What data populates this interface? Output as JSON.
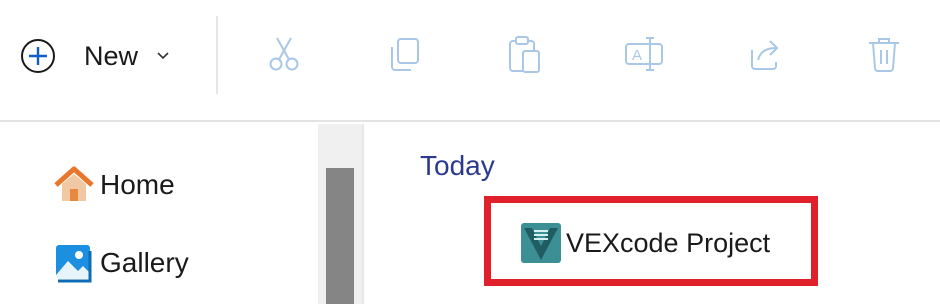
{
  "toolbar": {
    "new_label": "New",
    "tools": [
      {
        "icon": "cut-icon",
        "enabled": false
      },
      {
        "icon": "copy-icon",
        "enabled": false
      },
      {
        "icon": "paste-icon",
        "enabled": false
      },
      {
        "icon": "rename-icon",
        "enabled": false
      },
      {
        "icon": "share-icon",
        "enabled": false
      },
      {
        "icon": "delete-icon",
        "enabled": false
      }
    ]
  },
  "nav": {
    "items": [
      {
        "label": "Home",
        "icon": "home-icon"
      },
      {
        "label": "Gallery",
        "icon": "gallery-icon"
      }
    ]
  },
  "content": {
    "group_header": "Today",
    "files": [
      {
        "name": "VEXcode Project",
        "icon": "vexcode-file-icon",
        "highlighted": true
      }
    ]
  },
  "colors": {
    "accent_plus": "#0f5ec4",
    "disabled_icon": "#a9c8e8",
    "group_header": "#2b3a8f",
    "highlight_border": "#e0212b",
    "scroll_thumb": "#858585"
  }
}
